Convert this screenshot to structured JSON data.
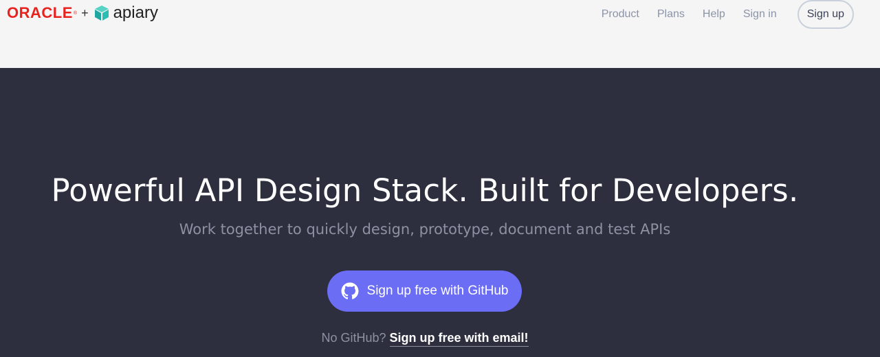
{
  "brand": {
    "oracle": "ORACLE",
    "registered": "®",
    "plus": "+",
    "apiary": "apiary",
    "oracle_color": "#e8231e",
    "apiary_mark_icon": "apiary-cube-icon"
  },
  "nav": {
    "items": [
      {
        "label": "Product"
      },
      {
        "label": "Plans"
      },
      {
        "label": "Help"
      },
      {
        "label": "Sign in"
      }
    ],
    "signup_label": "Sign up"
  },
  "hero": {
    "headline": "Powerful API Design Stack. Built for Developers.",
    "subhead": "Work together to quickly design, prototype, document and test APIs",
    "github_button_label": "Sign up free with GitHub",
    "github_icon": "github-icon",
    "alt_prefix": "No GitHub?",
    "alt_link": "Sign up free with email!",
    "background": "#2d2f3e",
    "button_color": "#6b6df4"
  }
}
